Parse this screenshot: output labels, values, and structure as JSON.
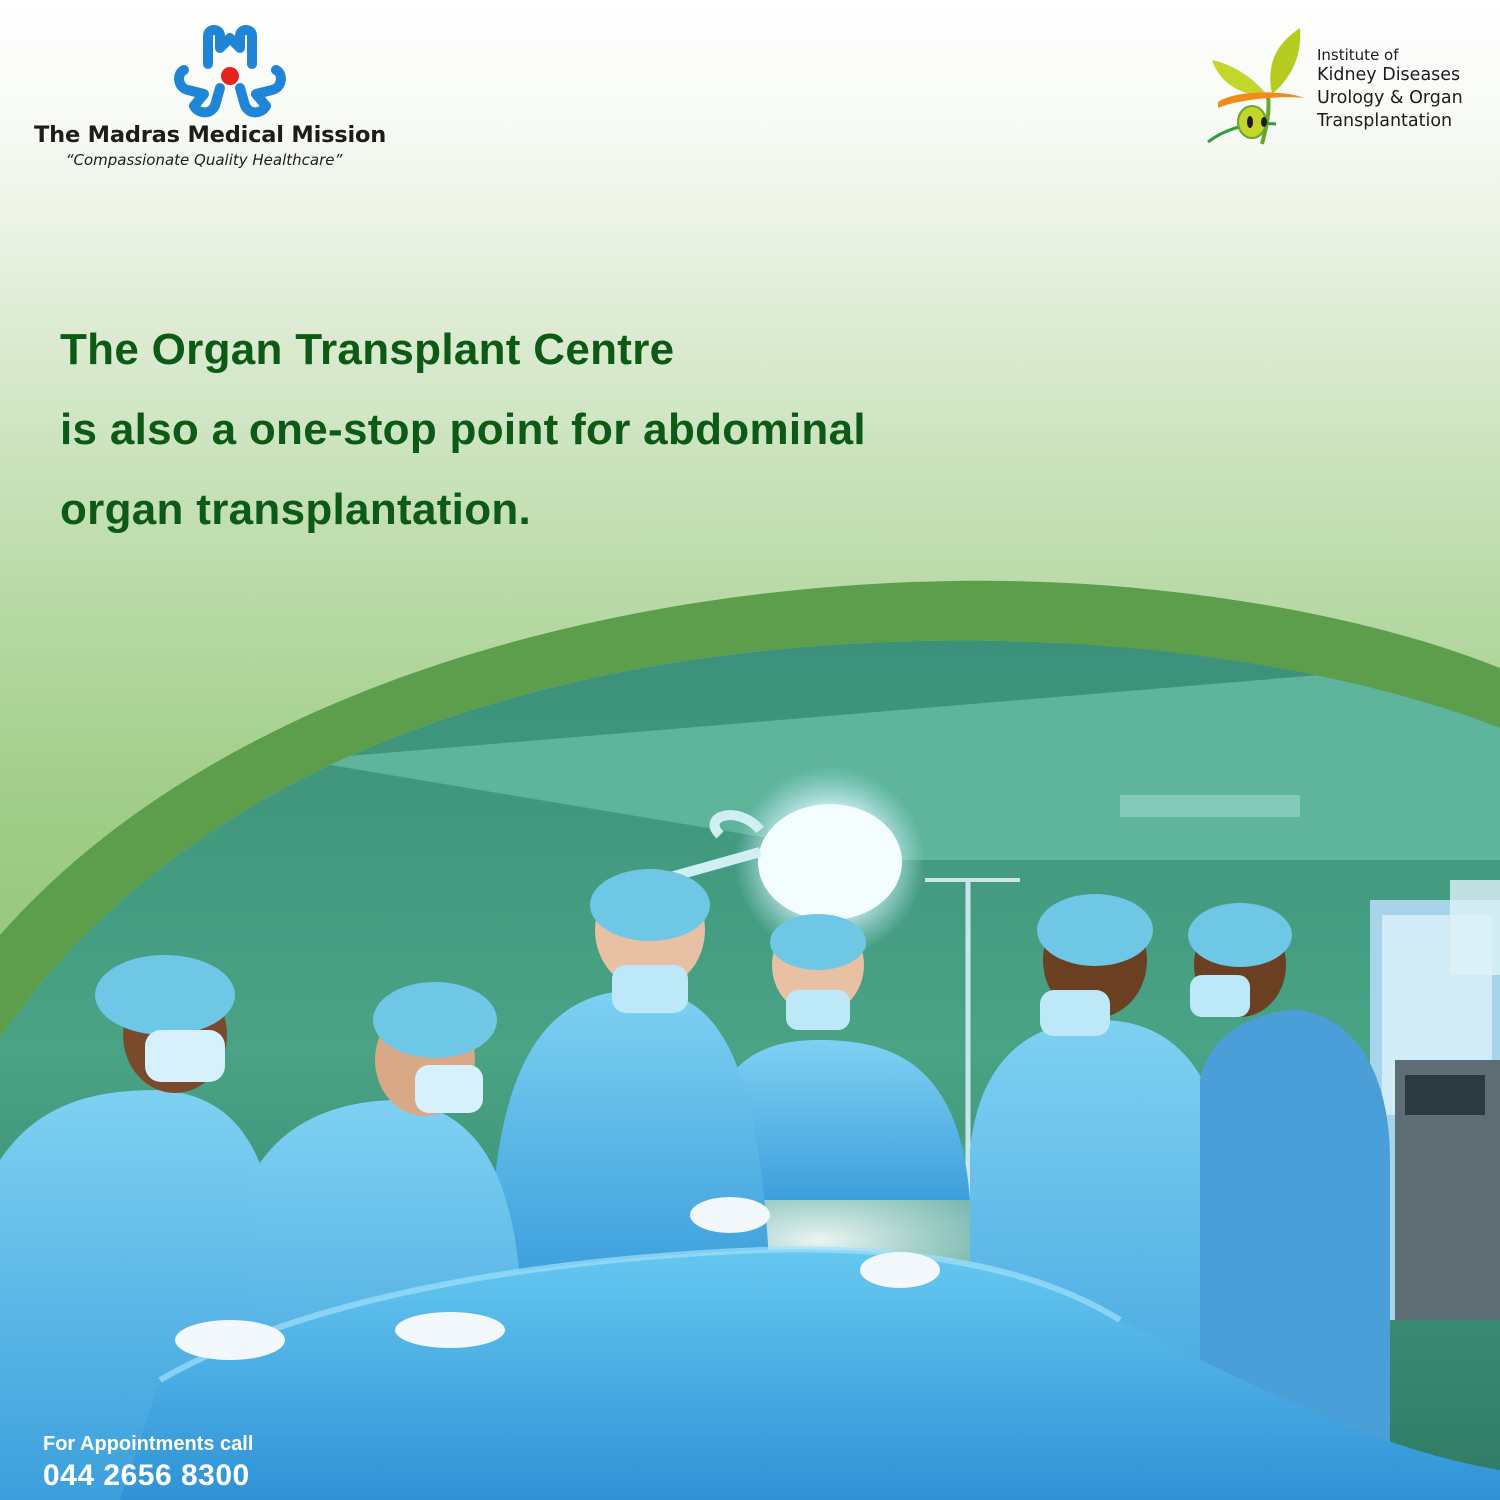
{
  "brand": {
    "name": "The Madras Medical Mission",
    "tagline": "“Compassionate Quality Healthcare”"
  },
  "institute": {
    "line1": "Institute of",
    "line2": "Kidney Diseases",
    "line3": "Urology & Organ",
    "line4": "Transplantation"
  },
  "headline": {
    "line1": "The Organ Transplant Centre",
    "line2": "is also a one-stop point for abdominal",
    "line3": "organ transplantation."
  },
  "appointment": {
    "label": "For Appointments call",
    "phone": "044 2656 8300"
  },
  "colors": {
    "headline": "#0d5a17",
    "band": "#5c9e4c",
    "brand_blue": "#1f85d6",
    "brand_red": "#e52421"
  },
  "icons": {
    "left_logo": "madras-medical-mission-logo",
    "right_logo": "sprout-kidney-logo"
  },
  "photo": {
    "subject": "surgeons-operating-theatre"
  }
}
